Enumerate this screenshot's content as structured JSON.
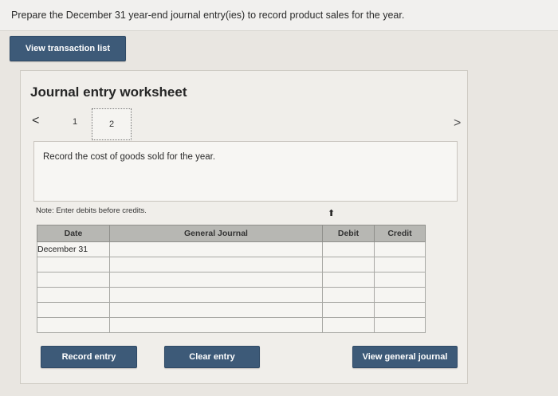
{
  "prompt": "Prepare the December 31 year-end journal entry(ies) to record product sales for the year.",
  "buttons": {
    "view_transaction_list": "View transaction list",
    "record_entry": "Record entry",
    "clear_entry": "Clear entry",
    "view_general_journal": "View general journal"
  },
  "worksheet": {
    "title": "Journal entry worksheet",
    "nav_prev": "<",
    "nav_next": ">",
    "pages": [
      "1",
      "2"
    ],
    "active_page": "2",
    "instruction": "Record the cost of goods sold for the year.",
    "note": "Note: Enter debits before credits."
  },
  "table": {
    "headers": [
      "Date",
      "General Journal",
      "Debit",
      "Credit"
    ],
    "rows": [
      {
        "date": "December 31",
        "account": "",
        "debit": "",
        "credit": ""
      },
      {
        "date": "",
        "account": "",
        "debit": "",
        "credit": ""
      },
      {
        "date": "",
        "account": "",
        "debit": "",
        "credit": ""
      },
      {
        "date": "",
        "account": "",
        "debit": "",
        "credit": ""
      },
      {
        "date": "",
        "account": "",
        "debit": "",
        "credit": ""
      },
      {
        "date": "",
        "account": "",
        "debit": "",
        "credit": ""
      }
    ]
  },
  "colors": {
    "button": "#3d5a78",
    "header": "#b7b7b3",
    "panel": "#f0eeea"
  }
}
